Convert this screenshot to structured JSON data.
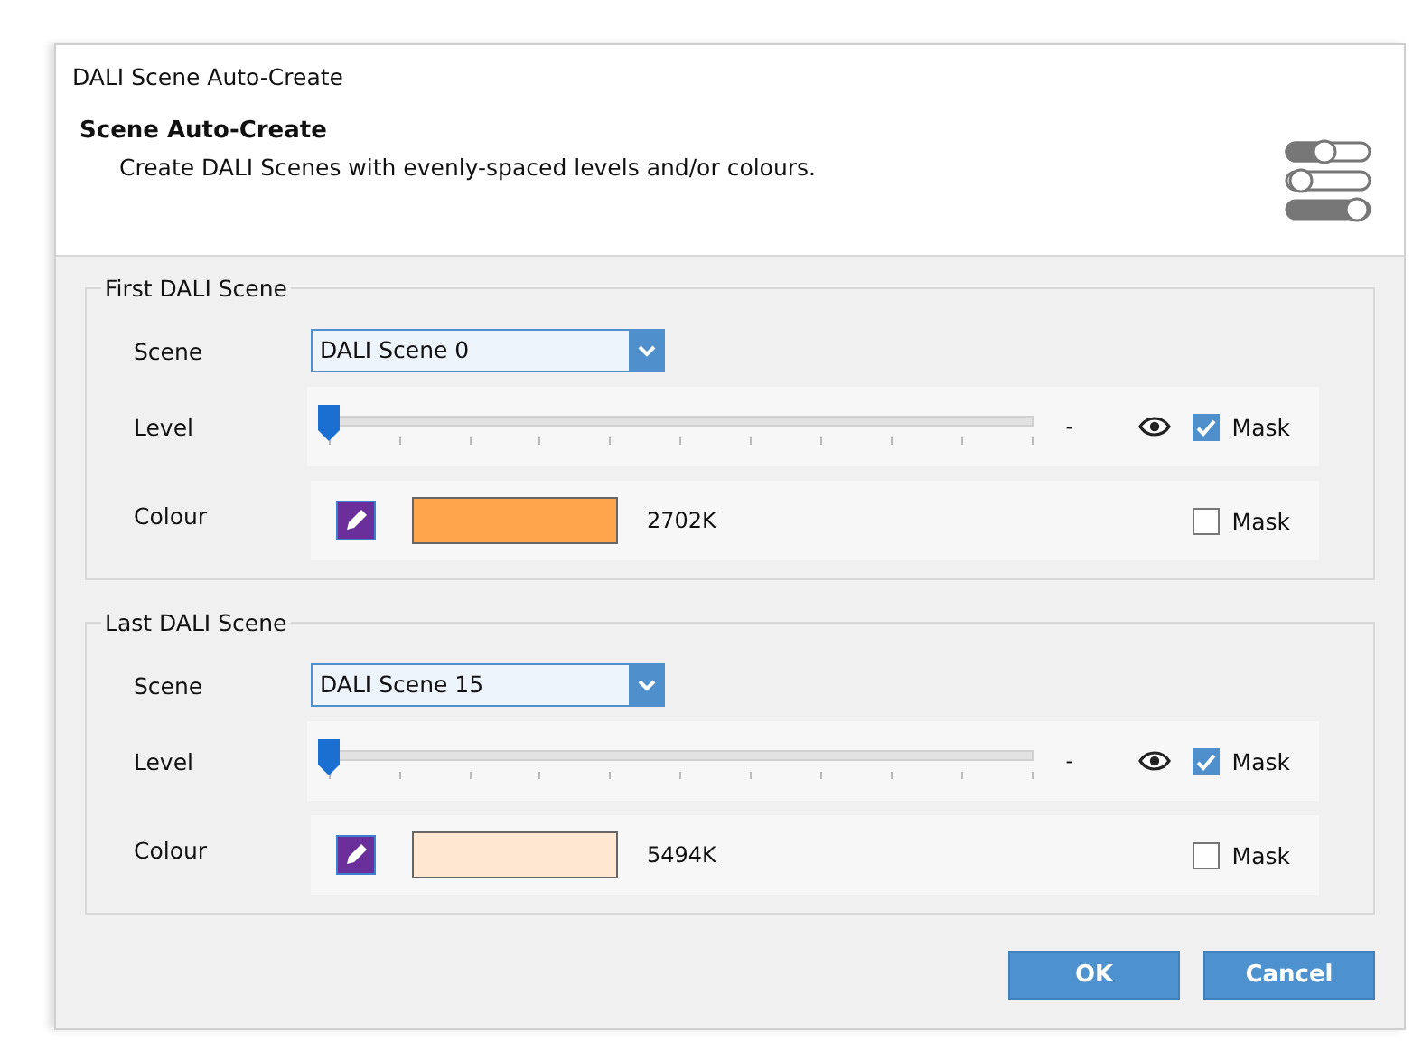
{
  "window": {
    "title": "DALI Scene Auto-Create"
  },
  "header": {
    "title": "Scene Auto-Create",
    "description": "Create DALI Scenes with evenly-spaced levels and/or colours."
  },
  "groups": [
    {
      "title": "First DALI Scene",
      "scene_label": "Scene",
      "scene": "DALI Scene 0",
      "level_label": "Level",
      "level": 0,
      "level_reading": "-",
      "level_mask_label": "Mask",
      "level_mask_checked": true,
      "colour_label": "Colour",
      "colour": {
        "color": "#ffa64d"
      },
      "colour_reading": "2702K",
      "colour_mask_label": "Mask",
      "colour_mask_checked": false
    },
    {
      "title": "Last DALI Scene",
      "scene_label": "Scene",
      "scene": "DALI Scene 15",
      "level_label": "Level",
      "level": 0,
      "level_reading": "-",
      "level_mask_label": "Mask",
      "level_mask_checked": true,
      "colour_label": "Colour",
      "colour": {
        "color": "#ffe7d2"
      },
      "colour_reading": "5494K",
      "colour_mask_label": "Mask",
      "colour_mask_checked": false
    }
  ],
  "buttons": [
    {
      "label": "OK"
    },
    {
      "label": "Cancel"
    }
  ]
}
